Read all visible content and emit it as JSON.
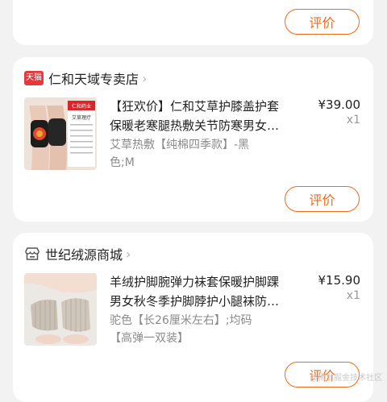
{
  "orders": [
    {
      "review_label": "评价"
    },
    {
      "shop": {
        "badge": "天猫",
        "name": "仁和天域专卖店"
      },
      "product": {
        "title_line1": "【狂欢价】仁和艾草护膝盖护套",
        "title_line2": "保暖老寒腿热敷关节防寒男女…",
        "spec_line1": "艾草热敷【纯棉四季款】-黑",
        "spec_line2": "色;M",
        "price": "¥39.00",
        "qty": "x1",
        "thumb_brand": "仁和药业",
        "thumb_label": "艾草理疗"
      },
      "review_label": "评价"
    },
    {
      "shop": {
        "name": "世纪绒源商城"
      },
      "product": {
        "title_line1": "羊绒护脚腕弹力袜套保暖护脚踝",
        "title_line2": "男女秋冬季护脚脖护小腿袜防…",
        "spec_line1": "驼色【长26厘米左右】;均码",
        "spec_line2": "【高弹一双装】",
        "price": "¥15.90",
        "qty": "x1"
      },
      "review_label": "评价"
    }
  ],
  "watermark": "@稀土掘金技术社区",
  "colors": {
    "accent": "#f06a1b",
    "tmall": "#e4393c",
    "background": "#f2f2f2"
  }
}
